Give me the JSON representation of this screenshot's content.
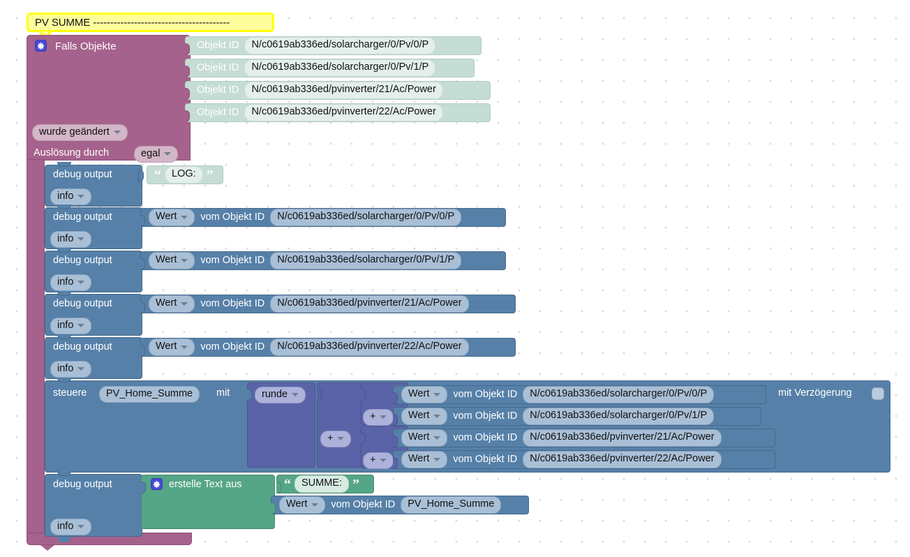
{
  "comment": {
    "text": "PV SUMME ----------------------------------------",
    "border_color": "#ffff00",
    "fill_color": "#feff9c"
  },
  "palette": {
    "trigger_pink": "#a5628c",
    "action_blue": "#5680a8",
    "math_purple": "#5b63a8",
    "text_green": "#55a587",
    "object_mint": "#c5ddd4",
    "canvas": "#ffffff",
    "grid_dot": "#dcdce0"
  },
  "trigger_block": {
    "gear_icon": "gear-icon",
    "title": "Falls Objekte",
    "object_rows": [
      {
        "label": "Objekt ID",
        "value": "N/c0619ab336ed/solarcharger/0/Pv/0/P"
      },
      {
        "label": "Objekt ID",
        "value": "N/c0619ab336ed/solarcharger/0/Pv/1/P"
      },
      {
        "label": "Objekt ID",
        "value": "N/c0619ab336ed/pvinverter/21/Ac/Power"
      },
      {
        "label": "Objekt ID",
        "value": "N/c0619ab336ed/pvinverter/22/Ac/Power"
      }
    ],
    "condition_dropdown": "wurde geändert",
    "trigger_by_label": "Auslösung durch",
    "trigger_by_dropdown": "egal"
  },
  "statements": {
    "debug_log": {
      "name": "debug output",
      "severity": "info",
      "text_value": "LOG:",
      "quote_open": "“",
      "quote_close": "”"
    },
    "debug_values": [
      {
        "name": "debug output",
        "severity": "info",
        "getter_dropdown": "Wert",
        "getter_label": "vom Objekt ID",
        "object_id": "N/c0619ab336ed/solarcharger/0/Pv/0/P"
      },
      {
        "name": "debug output",
        "severity": "info",
        "getter_dropdown": "Wert",
        "getter_label": "vom Objekt ID",
        "object_id": "N/c0619ab336ed/solarcharger/0/Pv/1/P"
      },
      {
        "name": "debug output",
        "severity": "info",
        "getter_dropdown": "Wert",
        "getter_label": "vom Objekt ID",
        "object_id": "N/c0619ab336ed/pvinverter/21/Ac/Power"
      },
      {
        "name": "debug output",
        "severity": "info",
        "getter_dropdown": "Wert",
        "getter_label": "vom Objekt ID",
        "object_id": "N/c0619ab336ed/pvinverter/22/Ac/Power"
      }
    ],
    "control_block": {
      "keyword": "steuere",
      "target_object": "PV_Home_Summe",
      "with_label": "mit",
      "delay_label": "mit Verzögerung",
      "delay_checked": false,
      "round_dropdown": "runde",
      "operators": [
        "+",
        "+",
        "+"
      ],
      "operands": [
        {
          "getter_dropdown": "Wert",
          "getter_label": "vom Objekt ID",
          "object_id": "N/c0619ab336ed/solarcharger/0/Pv/0/P"
        },
        {
          "getter_dropdown": "Wert",
          "getter_label": "vom Objekt ID",
          "object_id": "N/c0619ab336ed/solarcharger/0/Pv/1/P"
        },
        {
          "getter_dropdown": "Wert",
          "getter_label": "vom Objekt ID",
          "object_id": "N/c0619ab336ed/pvinverter/21/Ac/Power"
        },
        {
          "getter_dropdown": "Wert",
          "getter_label": "vom Objekt ID",
          "object_id": "N/c0619ab336ed/pvinverter/22/Ac/Power"
        }
      ]
    },
    "debug_summe": {
      "name": "debug output",
      "severity": "info",
      "create_text_label": "erstelle Text aus",
      "gear_icon": "gear-icon",
      "text_value": "SUMME:",
      "quote_open": "“",
      "quote_close": "”",
      "getter_dropdown": "Wert",
      "getter_label": "vom Objekt ID",
      "object_id": "PV_Home_Summe"
    }
  }
}
